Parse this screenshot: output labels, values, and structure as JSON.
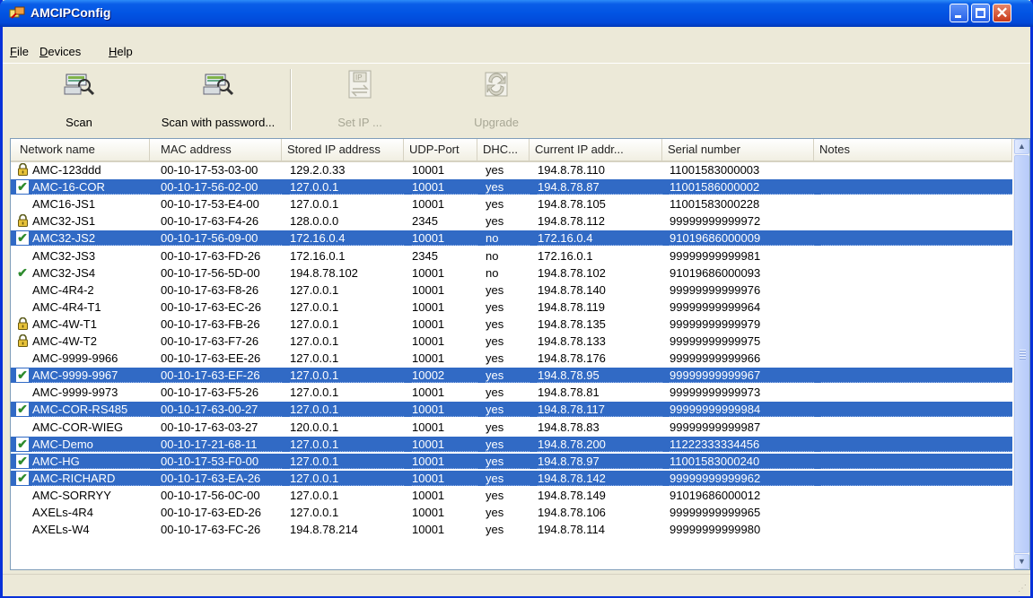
{
  "window": {
    "title": "AMCIPConfig"
  },
  "menu": [
    {
      "label": "File",
      "accel": "F",
      "rest": "ile"
    },
    {
      "label": "Devices",
      "accel": "D",
      "rest": "evices"
    },
    {
      "label": "Help",
      "accel": "H",
      "rest": "elp"
    }
  ],
  "toolbar": {
    "scan": "Scan",
    "scan_password": "Scan with password...",
    "set_ip": "Set IP ...",
    "set_ip_icon_text": "IP",
    "upgrade": "Upgrade"
  },
  "columns": [
    "Network name",
    "MAC address",
    "Stored IP address",
    "UDP-Port",
    "DHC...",
    "Current IP addr...",
    "Serial number",
    "Notes"
  ],
  "rows": [
    {
      "icon": "lock",
      "selected": false,
      "name": "AMC-123ddd",
      "mac": "00-10-17-53-03-00",
      "stored_ip": "129.2.0.33",
      "udp": "10001",
      "dhcp": "yes",
      "current_ip": "194.8.78.110",
      "serial": "11001583000003",
      "notes": ""
    },
    {
      "icon": "check",
      "selected": true,
      "name": "AMC-16-COR",
      "mac": "00-10-17-56-02-00",
      "stored_ip": "127.0.0.1",
      "udp": "10001",
      "dhcp": "yes",
      "current_ip": "194.8.78.87",
      "serial": "11001586000002",
      "notes": ""
    },
    {
      "icon": "",
      "selected": false,
      "name": "AMC16-JS1",
      "mac": "00-10-17-53-E4-00",
      "stored_ip": "127.0.0.1",
      "udp": "10001",
      "dhcp": "yes",
      "current_ip": "194.8.78.105",
      "serial": "11001583000228",
      "notes": ""
    },
    {
      "icon": "lock",
      "selected": false,
      "name": "AMC32-JS1",
      "mac": "00-10-17-63-F4-26",
      "stored_ip": "128.0.0.0",
      "udp": "2345",
      "dhcp": "yes",
      "current_ip": "194.8.78.112",
      "serial": "99999999999972",
      "notes": ""
    },
    {
      "icon": "check",
      "selected": true,
      "name": "AMC32-JS2",
      "mac": "00-10-17-56-09-00",
      "stored_ip": "172.16.0.4",
      "udp": "10001",
      "dhcp": "no",
      "current_ip": "172.16.0.4",
      "serial": "91019686000009",
      "notes": ""
    },
    {
      "icon": "",
      "selected": false,
      "name": "AMC32-JS3",
      "mac": "00-10-17-63-FD-26",
      "stored_ip": "172.16.0.1",
      "udp": "2345",
      "dhcp": "no",
      "current_ip": "172.16.0.1",
      "serial": "99999999999981",
      "notes": ""
    },
    {
      "icon": "check",
      "selected": false,
      "name": "AMC32-JS4",
      "mac": "00-10-17-56-5D-00",
      "stored_ip": "194.8.78.102",
      "udp": "10001",
      "dhcp": "no",
      "current_ip": "194.8.78.102",
      "serial": "91019686000093",
      "notes": ""
    },
    {
      "icon": "",
      "selected": false,
      "name": "AMC-4R4-2",
      "mac": "00-10-17-63-F8-26",
      "stored_ip": "127.0.0.1",
      "udp": "10001",
      "dhcp": "yes",
      "current_ip": "194.8.78.140",
      "serial": "99999999999976",
      "notes": ""
    },
    {
      "icon": "",
      "selected": false,
      "name": "AMC-4R4-T1",
      "mac": "00-10-17-63-EC-26",
      "stored_ip": "127.0.0.1",
      "udp": "10001",
      "dhcp": "yes",
      "current_ip": "194.8.78.119",
      "serial": "99999999999964",
      "notes": ""
    },
    {
      "icon": "lock",
      "selected": false,
      "name": "AMC-4W-T1",
      "mac": "00-10-17-63-FB-26",
      "stored_ip": "127.0.0.1",
      "udp": "10001",
      "dhcp": "yes",
      "current_ip": "194.8.78.135",
      "serial": "99999999999979",
      "notes": ""
    },
    {
      "icon": "lock",
      "selected": false,
      "name": "AMC-4W-T2",
      "mac": "00-10-17-63-F7-26",
      "stored_ip": "127.0.0.1",
      "udp": "10001",
      "dhcp": "yes",
      "current_ip": "194.8.78.133",
      "serial": "99999999999975",
      "notes": ""
    },
    {
      "icon": "",
      "selected": false,
      "name": "AMC-9999-9966",
      "mac": "00-10-17-63-EE-26",
      "stored_ip": "127.0.0.1",
      "udp": "10001",
      "dhcp": "yes",
      "current_ip": "194.8.78.176",
      "serial": "99999999999966",
      "notes": ""
    },
    {
      "icon": "check",
      "selected": true,
      "name": "AMC-9999-9967",
      "mac": "00-10-17-63-EF-26",
      "stored_ip": "127.0.0.1",
      "udp": "10002",
      "dhcp": "yes",
      "current_ip": "194.8.78.95",
      "serial": "99999999999967",
      "notes": ""
    },
    {
      "icon": "",
      "selected": false,
      "name": "AMC-9999-9973",
      "mac": "00-10-17-63-F5-26",
      "stored_ip": "127.0.0.1",
      "udp": "10001",
      "dhcp": "yes",
      "current_ip": "194.8.78.81",
      "serial": "99999999999973",
      "notes": ""
    },
    {
      "icon": "check",
      "selected": true,
      "name": "AMC-COR-RS485",
      "mac": "00-10-17-63-00-27",
      "stored_ip": "127.0.0.1",
      "udp": "10001",
      "dhcp": "yes",
      "current_ip": "194.8.78.117",
      "serial": "99999999999984",
      "notes": ""
    },
    {
      "icon": "",
      "selected": false,
      "name": "AMC-COR-WIEG",
      "mac": "00-10-17-63-03-27",
      "stored_ip": "120.0.0.1",
      "udp": "10001",
      "dhcp": "yes",
      "current_ip": "194.8.78.83",
      "serial": "99999999999987",
      "notes": ""
    },
    {
      "icon": "check",
      "selected": true,
      "name": "AMC-Demo",
      "mac": "00-10-17-21-68-11",
      "stored_ip": "127.0.0.1",
      "udp": "10001",
      "dhcp": "yes",
      "current_ip": "194.8.78.200",
      "serial": "11222333334456",
      "notes": ""
    },
    {
      "icon": "check",
      "selected": true,
      "name": "AMC-HG",
      "mac": "00-10-17-53-F0-00",
      "stored_ip": "127.0.0.1",
      "udp": "10001",
      "dhcp": "yes",
      "current_ip": "194.8.78.97",
      "serial": "11001583000240",
      "notes": ""
    },
    {
      "icon": "check",
      "selected": true,
      "name": "AMC-RICHARD",
      "mac": "00-10-17-63-EA-26",
      "stored_ip": "127.0.0.1",
      "udp": "10001",
      "dhcp": "yes",
      "current_ip": "194.8.78.142",
      "serial": "99999999999962",
      "notes": ""
    },
    {
      "icon": "",
      "selected": false,
      "name": "AMC-SORRYY",
      "mac": "00-10-17-56-0C-00",
      "stored_ip": "127.0.0.1",
      "udp": "10001",
      "dhcp": "yes",
      "current_ip": "194.8.78.149",
      "serial": "91019686000012",
      "notes": ""
    },
    {
      "icon": "",
      "selected": false,
      "name": "AXELs-4R4",
      "mac": "00-10-17-63-ED-26",
      "stored_ip": "127.0.0.1",
      "udp": "10001",
      "dhcp": "yes",
      "current_ip": "194.8.78.106",
      "serial": "99999999999965",
      "notes": ""
    },
    {
      "icon": "",
      "selected": false,
      "name": "AXELs-W4",
      "mac": "00-10-17-63-FC-26",
      "stored_ip": "194.8.78.214",
      "udp": "10001",
      "dhcp": "yes",
      "current_ip": "194.8.78.114",
      "serial": "99999999999980",
      "notes": ""
    }
  ],
  "colors": {
    "titlebar": "#0254E3",
    "selection": "#316AC5",
    "check": "#2E8B2E",
    "window_bg": "#ECE9D8"
  }
}
